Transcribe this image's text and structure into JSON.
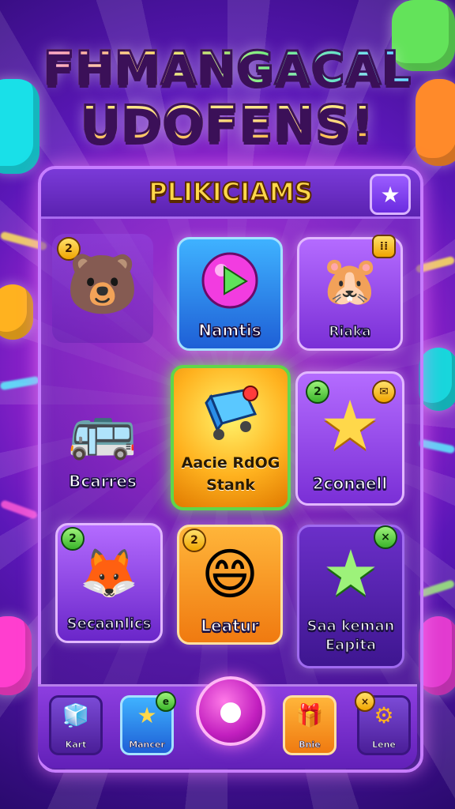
{
  "header": {
    "title_line1": "FHMANGACAL",
    "title_line2": "UDOFENS!"
  },
  "panel": {
    "title": "PLIKICIAMS",
    "star_button_icon": "star-icon"
  },
  "levels": [
    {
      "label": "",
      "badge": "2",
      "icon": "bear-character-icon"
    },
    {
      "label": "Namtis",
      "badge": "",
      "icon": "play-ball-icon"
    },
    {
      "label": "Riaka",
      "badge": "⁞⁞",
      "icon": "hamster-character-icon"
    },
    {
      "label": "Bcarres",
      "badge": "",
      "icon": "bus-icon"
    },
    {
      "label": "Aacie RdOG Stank",
      "badge": "",
      "icon": "gem-cart-icon"
    },
    {
      "label": "2conaell",
      "badge": "2",
      "icon": "star-icon"
    },
    {
      "label": "Secaanlics",
      "badge": "2",
      "icon": "fox-character-icon"
    },
    {
      "label": "Leatur",
      "badge": "2",
      "icon": "smiley-icon"
    },
    {
      "label": "Saa keman Eapita",
      "badge": "×",
      "icon": "green-star-icon"
    }
  ],
  "nav": [
    {
      "label": "Kart",
      "icon": "cube-icon"
    },
    {
      "label": "Mancer",
      "icon": "star-icon",
      "badge": "e"
    },
    {
      "label": "",
      "icon": "home-gem-icon"
    },
    {
      "label": "Bnie",
      "icon": "chest-icon"
    },
    {
      "label": "Lene",
      "icon": "gear-icon",
      "badge": "×"
    }
  ],
  "colors": {
    "accent": "#ffd84a",
    "panel_border": "#c77dff",
    "highlight_tile": "#5fd64a"
  }
}
